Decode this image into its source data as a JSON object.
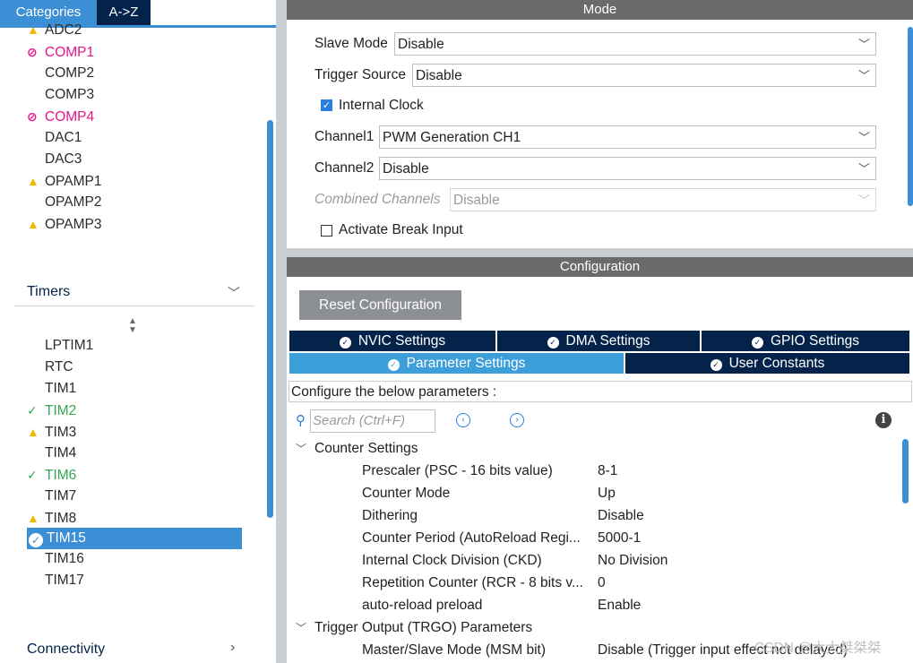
{
  "left": {
    "tabs": {
      "categories": "Categories",
      "az": "A->Z"
    },
    "analog_items": [
      {
        "label": "ADC2",
        "status": "warning"
      },
      {
        "label": "COMP1",
        "status": "error"
      },
      {
        "label": "COMP2",
        "status": "none"
      },
      {
        "label": "COMP3",
        "status": "none"
      },
      {
        "label": "COMP4",
        "status": "error"
      },
      {
        "label": "DAC1",
        "status": "none"
      },
      {
        "label": "DAC3",
        "status": "none"
      },
      {
        "label": "OPAMP1",
        "status": "warning"
      },
      {
        "label": "OPAMP2",
        "status": "none"
      },
      {
        "label": "OPAMP3",
        "status": "warning"
      }
    ],
    "timers_label": "Timers",
    "timer_items": [
      {
        "label": "LPTIM1",
        "status": "none"
      },
      {
        "label": "RTC",
        "status": "none"
      },
      {
        "label": "TIM1",
        "status": "none"
      },
      {
        "label": "TIM2",
        "status": "ok"
      },
      {
        "label": "TIM3",
        "status": "warning"
      },
      {
        "label": "TIM4",
        "status": "none"
      },
      {
        "label": "TIM6",
        "status": "ok"
      },
      {
        "label": "TIM7",
        "status": "none"
      },
      {
        "label": "TIM8",
        "status": "warning"
      },
      {
        "label": "TIM15",
        "status": "selected"
      },
      {
        "label": "TIM16",
        "status": "none"
      },
      {
        "label": "TIM17",
        "status": "none"
      }
    ],
    "connectivity_label": "Connectivity"
  },
  "mode": {
    "header": "Mode",
    "slave_mode": {
      "label": "Slave Mode",
      "value": "Disable"
    },
    "trigger_source": {
      "label": "Trigger Source",
      "value": "Disable"
    },
    "internal_clock": {
      "label": "Internal Clock",
      "checked": true
    },
    "channel1": {
      "label": "Channel1",
      "value": "PWM Generation CH1"
    },
    "channel2": {
      "label": "Channel2",
      "value": "Disable"
    },
    "combined_channels": {
      "label": "Combined Channels",
      "value": "Disable"
    },
    "break_input": {
      "label": "Activate Break Input",
      "checked": false
    }
  },
  "config": {
    "header": "Configuration",
    "reset_button": "Reset Configuration",
    "tabs": {
      "nvic": "NVIC Settings",
      "dma": "DMA Settings",
      "gpio": "GPIO Settings",
      "parameter": "Parameter Settings",
      "user_constants": "User Constants"
    },
    "note": "Configure the below parameters :",
    "search_placeholder": "Search (Ctrl+F)",
    "groups": {
      "counter": "Counter Settings",
      "trgo": "Trigger Output (TRGO) Parameters"
    },
    "counter_params": [
      {
        "name": "Prescaler (PSC - 16 bits value)",
        "value": "8-1"
      },
      {
        "name": "Counter Mode",
        "value": "Up"
      },
      {
        "name": "Dithering",
        "value": "Disable"
      },
      {
        "name": "Counter Period (AutoReload Regi...",
        "value": "5000-1"
      },
      {
        "name": "Internal Clock Division (CKD)",
        "value": "No Division"
      },
      {
        "name": "Repetition Counter (RCR - 8 bits v...",
        "value": "0"
      },
      {
        "name": "auto-reload preload",
        "value": "Enable"
      }
    ],
    "trgo_params": [
      {
        "name": "Master/Slave Mode (MSM bit)",
        "value": "Disable (Trigger input effect not delayed)"
      }
    ]
  },
  "watermark": "CSDN @大大桀桀桀",
  "colors": {
    "accent": "#3c8fd4",
    "navy": "#03234b",
    "error": "#e5148a",
    "ok": "#35a853",
    "warning": "#f5b800"
  }
}
